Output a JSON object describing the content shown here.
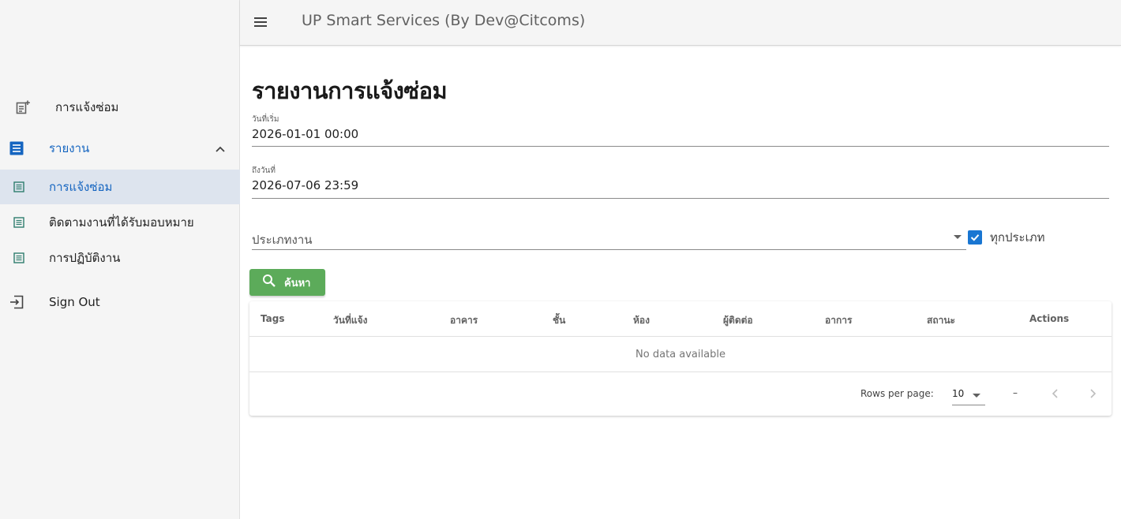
{
  "app": {
    "title": "UP Smart Services (By Dev@Citcoms)"
  },
  "sidebar": {
    "items": [
      {
        "label": "การแจ้งซ่อม",
        "icon": "note-add-icon"
      },
      {
        "label": "รายงาน",
        "icon": "list-report-icon",
        "expanded": true
      },
      {
        "label": "การแจ้งซ่อม",
        "icon": "list-icon",
        "active": true
      },
      {
        "label": "ติดตามงานที่ได้รับมอบหมาย",
        "icon": "list-icon"
      },
      {
        "label": "การปฏิบัติงาน",
        "icon": "list-icon"
      },
      {
        "label": "Sign Out",
        "icon": "sign-out-icon"
      }
    ]
  },
  "main": {
    "title": "รายงานการแจ้งซ่อม",
    "start_date": {
      "label": "วันที่เริ่ม",
      "value": "2026-01-01 00:00"
    },
    "end_date": {
      "label": "ถึงวันที่",
      "value": "2026-07-06 23:59"
    },
    "job_type": {
      "label": "ประเภทงาน"
    },
    "all_types": {
      "label": "ทุกประเภท",
      "checked": true
    },
    "search_button": "ค้นหา"
  },
  "table": {
    "headers": [
      "Tags",
      "วันที่แจ้ง",
      "อาคาร",
      "ชั้น",
      "ห้อง",
      "ผู้ติดต่อ",
      "อาการ",
      "สถานะ",
      "Actions"
    ],
    "empty_text": "No data available",
    "rows_per_page_label": "Rows per page:",
    "rows_per_page": "10",
    "page_range": "–"
  },
  "colors": {
    "accent": "#1976d2",
    "search_button": "#5cab5a",
    "active_nav": "#dde4ee"
  }
}
